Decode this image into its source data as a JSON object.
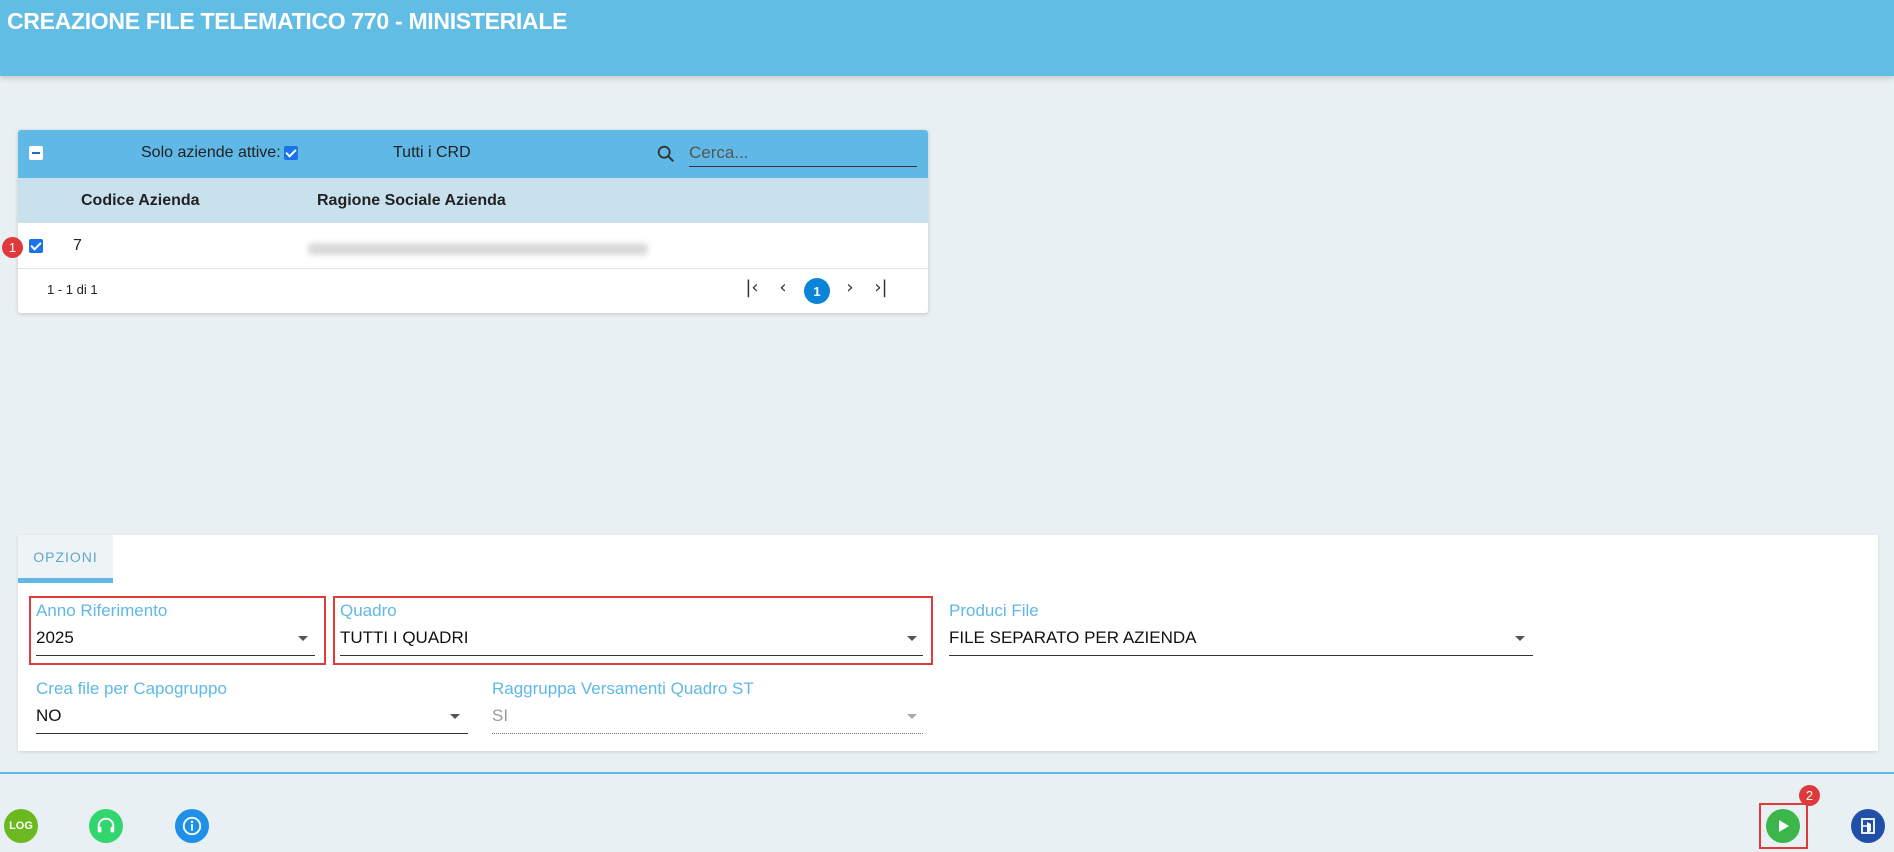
{
  "header": {
    "title": "CREAZIONE FILE TELEMATICO 770 - MINISTERIALE"
  },
  "grid": {
    "active_only_label": "Solo aziende attive:",
    "crd_label": "Tutti i CRD",
    "search_placeholder": "Cerca...",
    "columns": [
      "Codice Azienda",
      "Ragione Sociale Azienda"
    ],
    "rows": [
      {
        "code": "7",
        "name_redacted": true
      }
    ],
    "pager_info": "1 - 1 di 1",
    "current_page": "1"
  },
  "markers": {
    "first": "1",
    "second": "2"
  },
  "options": {
    "tab_label": "OPZIONI",
    "anno": {
      "label": "Anno Riferimento",
      "value": "2025"
    },
    "quadro": {
      "label": "Quadro",
      "value": "TUTTI I QUADRI"
    },
    "produci": {
      "label": "Produci File",
      "value": "FILE SEPARATO PER AZIENDA"
    },
    "capogruppo": {
      "label": "Crea file per Capogruppo",
      "value": "NO"
    },
    "raggruppa": {
      "label": "Raggruppa Versamenti Quadro ST",
      "value": "SI"
    }
  },
  "footer": {
    "log_label": "LOG"
  },
  "colors": {
    "header": "#62bde5",
    "accent": "#5fb8e6",
    "highlight": "#e03b3b",
    "run": "#3cb54a",
    "log": "#6cb91f",
    "support": "#32d66e",
    "info": "#1e90e8",
    "exit": "#1f4fa6"
  }
}
